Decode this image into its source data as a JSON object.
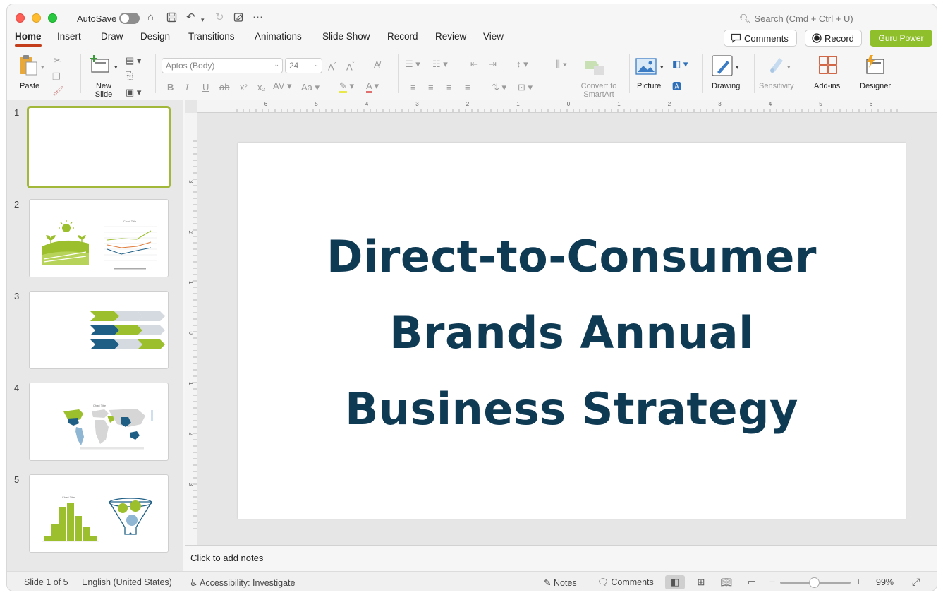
{
  "window": {
    "autosave_label": "AutoSave",
    "search_placeholder": "Search (Cmd + Ctrl + U)"
  },
  "tabs": [
    "Home",
    "Insert",
    "Draw",
    "Design",
    "Transitions",
    "Animations",
    "Slide Show",
    "Record",
    "Review",
    "View"
  ],
  "header_buttons": {
    "comments": "Comments",
    "record": "Record",
    "guru": "Guru Power"
  },
  "ribbon": {
    "paste": "Paste",
    "new_slide_1": "New",
    "new_slide_2": "Slide",
    "font_name": "Aptos (Body)",
    "font_size": "24",
    "convert_1": "Convert to",
    "convert_2": "SmartArt",
    "picture": "Picture",
    "drawing": "Drawing",
    "sensitivity": "Sensitivity",
    "addins": "Add-ins",
    "designer": "Designer"
  },
  "thumbnails": [
    {
      "num": "1"
    },
    {
      "num": "2",
      "chart_title": "Chart Title"
    },
    {
      "num": "3"
    },
    {
      "num": "4",
      "chart_title": "Chart Title"
    },
    {
      "num": "5",
      "chart_title": "Chart Title"
    }
  ],
  "ruler": {
    "h_labels": [
      "6",
      "5",
      "4",
      "3",
      "2",
      "1",
      "0",
      "1",
      "2",
      "3",
      "4",
      "5",
      "6"
    ],
    "v_labels": [
      "3",
      "2",
      "1",
      "0",
      "1",
      "2",
      "3"
    ]
  },
  "slide": {
    "title_line1": "Direct-to-Consumer",
    "title_line2": "Brands Annual",
    "title_line3": "Business Strategy",
    "title_color": "#0f3a54"
  },
  "notes_placeholder": "Click to add notes",
  "status": {
    "slide_indicator": "Slide 1 of 5",
    "language": "English (United States)",
    "accessibility": "Accessibility: Investigate",
    "notes": "Notes",
    "comments": "Comments",
    "zoom": "99%"
  },
  "colors": {
    "accent": "#c43e1c",
    "guru": "#8fbf2a",
    "selection": "#a2b83a",
    "green": "#9bbf2d",
    "blue": "#1f5f86"
  }
}
